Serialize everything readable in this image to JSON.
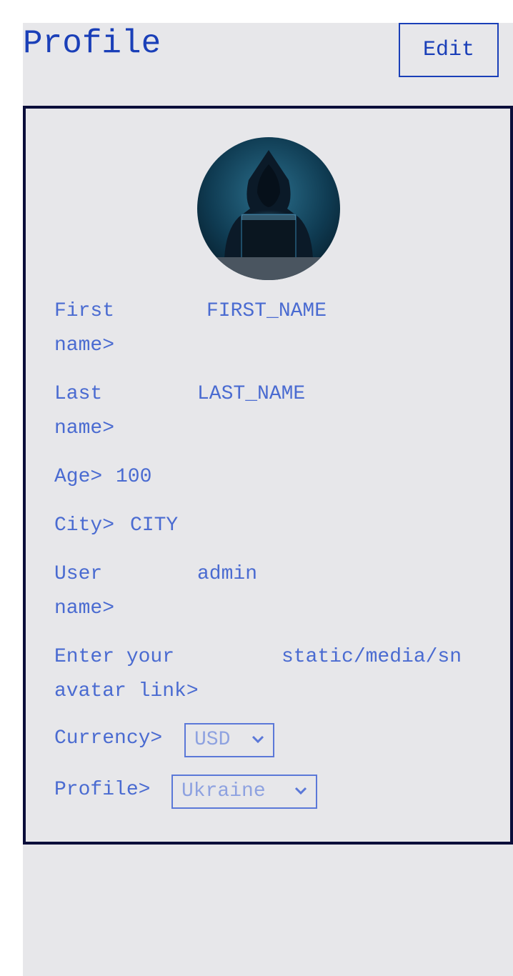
{
  "header": {
    "title": "Profile",
    "edit_label": "Edit"
  },
  "profile": {
    "avatar_icon": "hooded-hacker-avatar",
    "first_name": {
      "label": "First\nname>",
      "value": "FIRST_NAME"
    },
    "last_name": {
      "label": "Last\nname>",
      "value": "LAST_NAME"
    },
    "age": {
      "label": "Age>",
      "value": "100"
    },
    "city": {
      "label": "City>",
      "value": "CITY"
    },
    "username": {
      "label": "User\nname>",
      "value": "admin"
    },
    "avatar_link": {
      "label": "Enter your\navatar link>",
      "value": "static/media/sn"
    },
    "currency": {
      "label": "Currency>",
      "value": "USD"
    },
    "profile_select": {
      "label": "Profile>",
      "value": "Ukraine"
    }
  },
  "colors": {
    "accent": "#1a3fb8",
    "text": "#4a6bd1",
    "background": "#e7e7ea",
    "card_border": "#0b0e3a"
  }
}
